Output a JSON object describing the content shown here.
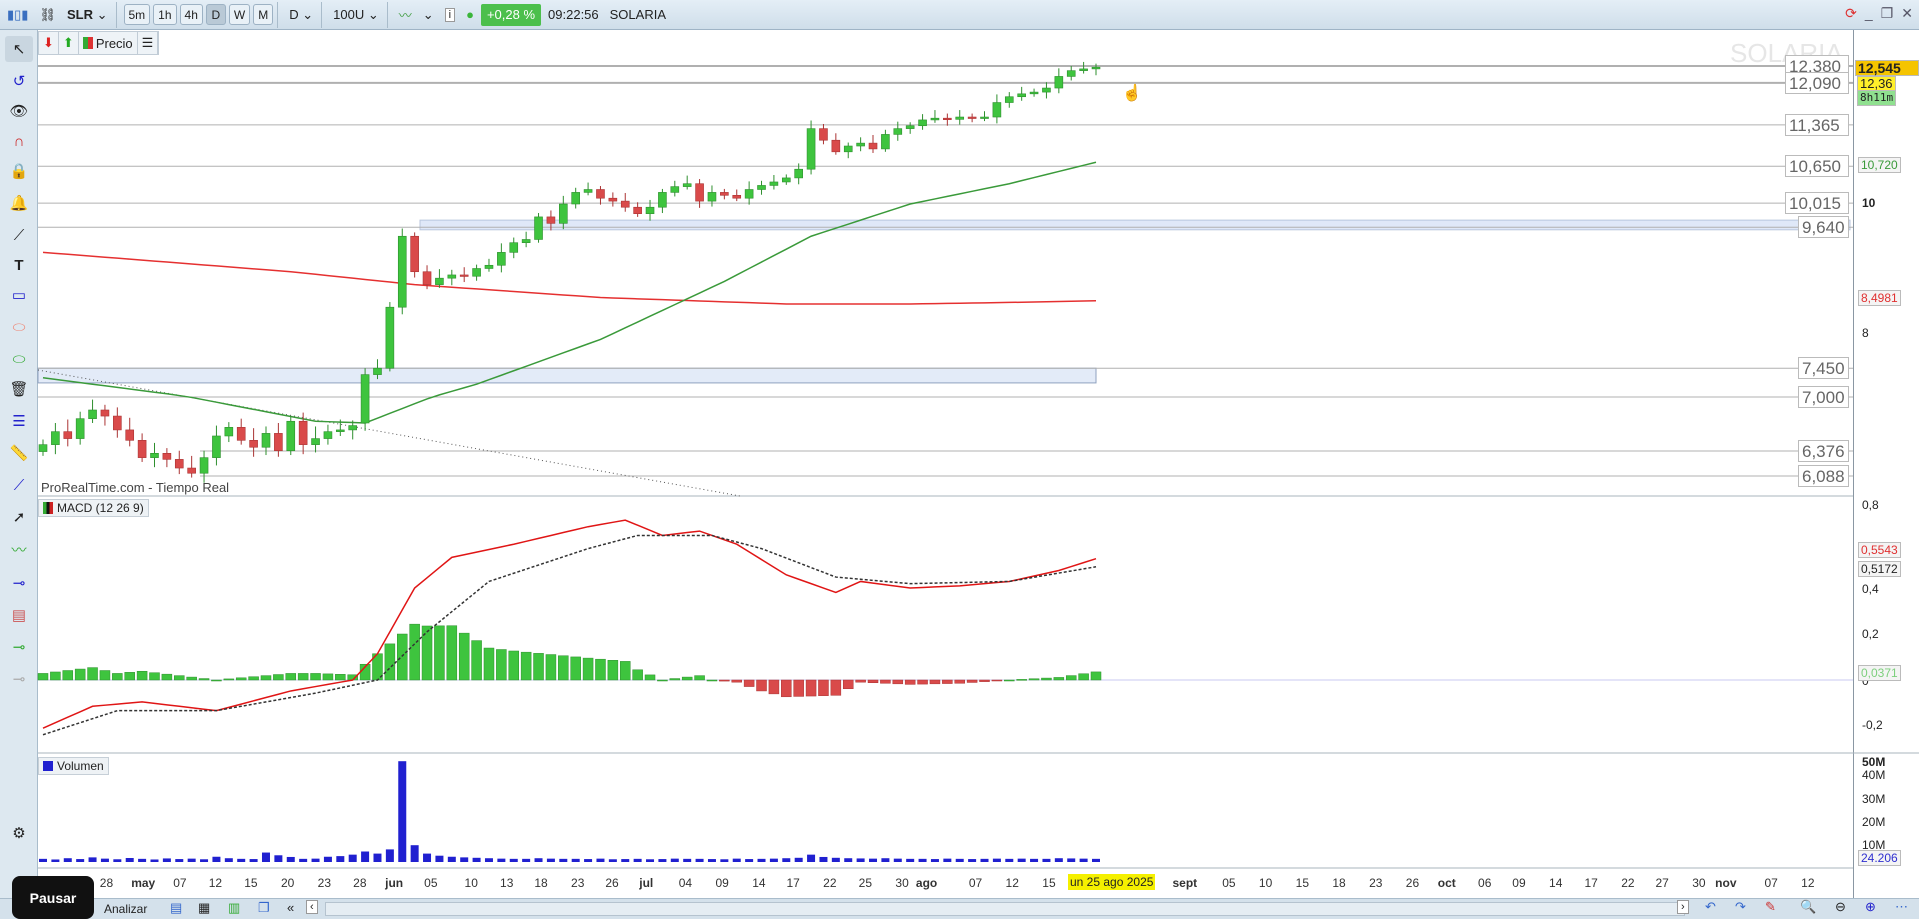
{
  "toolbar": {
    "symbol": "SLR",
    "timeframes": [
      "5m",
      "1h",
      "4h",
      "D",
      "W",
      "M"
    ],
    "active_timeframe": "D",
    "period": "D",
    "units": "100U",
    "change": "+0,28 %",
    "time": "09:22:56",
    "name": "SOLARIA",
    "info": "i"
  },
  "subtoolbar": {
    "price_label": "Precio"
  },
  "main_panel": {
    "watermark": "SOLARIA",
    "source": "ProRealTime.com - Tiempo Real",
    "level_labels": [
      "12,380",
      "12,090",
      "11,365",
      "10,650",
      "10,015",
      "9,640",
      "7,450",
      "7,000",
      "6,376",
      "6,088"
    ],
    "axis_ticks": [
      "10",
      "8"
    ],
    "tags": {
      "last": "12,545",
      "cursor": "12,36",
      "countdown": "8h11m",
      "ma_green": "10,720",
      "ma_red": "8,4981"
    }
  },
  "macd_panel": {
    "title": "MACD (12 26 9)",
    "axis_ticks": [
      "0,8",
      "0,4",
      "0,2",
      "0",
      "-0,2"
    ],
    "tags": {
      "macd": "0,5543",
      "signal": "0,5172",
      "hist": "0,0371"
    }
  },
  "volume_panel": {
    "title": "Volumen",
    "axis_ticks": [
      "50M",
      "40M",
      "30M",
      "20M",
      "10M"
    ],
    "tag": "24.206"
  },
  "date_axis": {
    "labels": [
      "28",
      "may",
      "07",
      "12",
      "15",
      "20",
      "23",
      "28",
      "jun",
      "05",
      "10",
      "13",
      "18",
      "23",
      "26",
      "jul",
      "04",
      "09",
      "14",
      "17",
      "22",
      "25",
      "30",
      "ago",
      "07",
      "12",
      "15",
      "sept",
      "05",
      "10",
      "15",
      "18",
      "23",
      "26",
      "oct",
      "06",
      "09",
      "14",
      "17",
      "22",
      "27",
      "30",
      "nov",
      "07",
      "12"
    ],
    "cursor_date": "un 25 ago 2025"
  },
  "bottombar": {
    "pause": "Pausar",
    "analyze": "Analizar"
  },
  "colors": {
    "up": "#3ec43e",
    "down": "#d94a4a",
    "ma_red": "#e53030",
    "ma_green": "#3a9a3a",
    "volume": "#2020d0"
  },
  "chart_data": {
    "type": "candlestick",
    "closes": [
      6.45,
      6.6,
      6.52,
      6.75,
      6.85,
      6.78,
      6.62,
      6.5,
      6.3,
      6.35,
      6.28,
      6.18,
      6.12,
      6.3,
      6.55,
      6.65,
      6.5,
      6.42,
      6.58,
      6.38,
      6.72,
      6.45,
      6.52,
      6.6,
      6.62,
      6.67,
      7.35,
      7.45,
      8.4,
      9.5,
      8.95,
      8.75,
      8.85,
      8.9,
      8.88,
      9.0,
      9.05,
      9.25,
      9.4,
      9.45,
      9.8,
      9.7,
      10.0,
      10.2,
      10.25,
      10.1,
      10.05,
      9.95,
      9.85,
      9.95,
      10.2,
      10.3,
      10.35,
      10.05,
      10.2,
      10.15,
      10.1,
      10.25,
      10.32,
      10.38,
      10.45,
      10.6,
      11.3,
      11.1,
      10.9,
      11.0,
      11.05,
      10.95,
      11.2,
      11.3,
      11.35,
      11.45,
      11.48,
      11.46,
      11.5,
      11.48,
      11.5,
      11.75,
      11.85,
      11.9,
      11.93,
      12.0,
      12.2,
      12.3,
      12.33,
      12.36
    ],
    "ma_red": [
      [
        0,
        9.25
      ],
      [
        10,
        9.1
      ],
      [
        20,
        8.95
      ],
      [
        30,
        8.75
      ],
      [
        45,
        8.55
      ],
      [
        60,
        8.45
      ],
      [
        70,
        8.45
      ],
      [
        80,
        8.48
      ],
      [
        85,
        8.5
      ]
    ],
    "ma_green": [
      [
        0,
        7.3
      ],
      [
        10,
        7.05
      ],
      [
        22,
        6.72
      ],
      [
        26,
        6.7
      ],
      [
        35,
        7.2
      ],
      [
        45,
        7.9
      ],
      [
        55,
        8.8
      ],
      [
        62,
        9.5
      ],
      [
        70,
        10.0
      ],
      [
        78,
        10.35
      ],
      [
        85,
        10.72
      ]
    ],
    "macd": [
      [
        0,
        -0.22
      ],
      [
        4,
        -0.12
      ],
      [
        8,
        -0.1
      ],
      [
        14,
        -0.14
      ],
      [
        20,
        -0.05
      ],
      [
        25,
        0.0
      ],
      [
        27,
        0.12
      ],
      [
        30,
        0.42
      ],
      [
        33,
        0.56
      ],
      [
        38,
        0.62
      ],
      [
        44,
        0.7
      ],
      [
        47,
        0.73
      ],
      [
        50,
        0.66
      ],
      [
        53,
        0.68
      ],
      [
        56,
        0.62
      ],
      [
        60,
        0.48
      ],
      [
        64,
        0.4
      ],
      [
        66,
        0.45
      ],
      [
        70,
        0.42
      ],
      [
        74,
        0.43
      ],
      [
        78,
        0.45
      ],
      [
        82,
        0.5
      ],
      [
        85,
        0.554
      ]
    ],
    "signal": [
      [
        0,
        -0.25
      ],
      [
        6,
        -0.14
      ],
      [
        14,
        -0.14
      ],
      [
        22,
        -0.06
      ],
      [
        27,
        0.0
      ],
      [
        31,
        0.22
      ],
      [
        36,
        0.45
      ],
      [
        44,
        0.6
      ],
      [
        48,
        0.66
      ],
      [
        54,
        0.66
      ],
      [
        58,
        0.6
      ],
      [
        64,
        0.47
      ],
      [
        70,
        0.44
      ],
      [
        78,
        0.45
      ],
      [
        85,
        0.517
      ]
    ],
    "volume_m": [
      1.5,
      1.2,
      1.8,
      1.4,
      2.2,
      1.6,
      1.3,
      1.9,
      1.5,
      1.2,
      1.7,
      1.4,
      1.6,
      1.3,
      2.5,
      1.8,
      1.5,
      1.4,
      4.5,
      3.2,
      2.4,
      1.5,
      1.6,
      2.5,
      2.8,
      3.5,
      5,
      4,
      6,
      48,
      8,
      4,
      3,
      2.5,
      2.2,
      2,
      1.8,
      1.6,
      1.5,
      1.5,
      1.8,
      1.6,
      1.5,
      1.5,
      1.4,
      1.6,
      1.3,
      1.4,
      1.5,
      1.3,
      1.4,
      1.6,
      1.5,
      1.5,
      1.4,
      1.3,
      1.6,
      1.4,
      1.5,
      1.6,
      1.8,
      2.0,
      3.5,
      2.4,
      2.0,
      1.8,
      1.7,
      1.6,
      1.8,
      1.6,
      1.5,
      1.5,
      1.4,
      1.6,
      1.5,
      1.4,
      1.5,
      1.6,
      1.5,
      1.6,
      1.5,
      1.5,
      1.8,
      1.7,
      1.6,
      1.5
    ],
    "levels": [
      12.38,
      12.09,
      11.365,
      10.65,
      10.015,
      9.64,
      7.45,
      7.0,
      6.376,
      6.088
    ]
  }
}
